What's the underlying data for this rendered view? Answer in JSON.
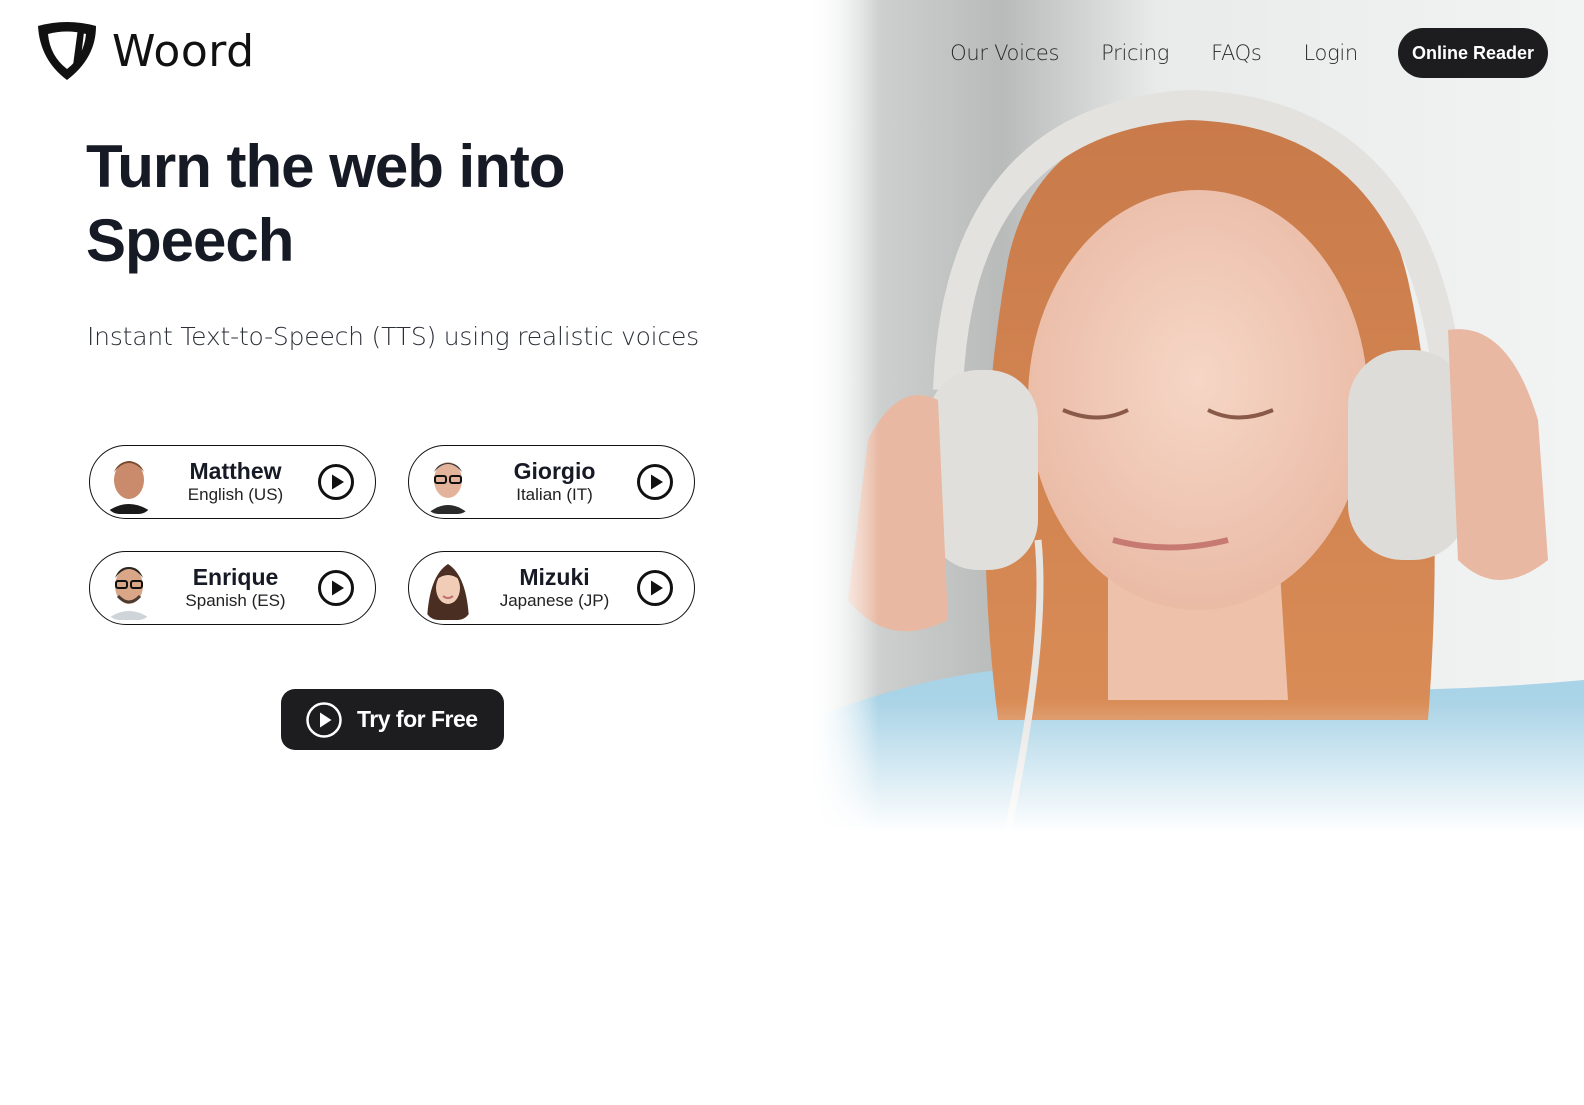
{
  "brand": {
    "name": "Woord",
    "logo_icon": "shield-logo-icon"
  },
  "nav": {
    "links": [
      {
        "label": "Our Voices"
      },
      {
        "label": "Pricing"
      },
      {
        "label": "FAQs"
      },
      {
        "label": "Login"
      }
    ],
    "cta_label": "Online Reader"
  },
  "hero": {
    "headline": "Turn the web into Speech",
    "subheadline": "Instant Text-to-Speech (TTS) using realistic voices",
    "image_alt": "Girl with red hair wearing white headphones, eyes closed"
  },
  "voices": [
    {
      "name": "Matthew",
      "language": "English (US)",
      "icon": "play-icon"
    },
    {
      "name": "Giorgio",
      "language": "Italian (IT)",
      "icon": "play-icon"
    },
    {
      "name": "Enrique",
      "language": "Spanish (ES)",
      "icon": "play-icon"
    },
    {
      "name": "Mizuki",
      "language": "Japanese (JP)",
      "icon": "play-icon"
    }
  ],
  "cta": {
    "label": "Try for Free",
    "icon": "play-circle-icon"
  },
  "colors": {
    "primary_dark": "#1d1d1f",
    "text": "#161a24",
    "background": "#ffffff"
  }
}
